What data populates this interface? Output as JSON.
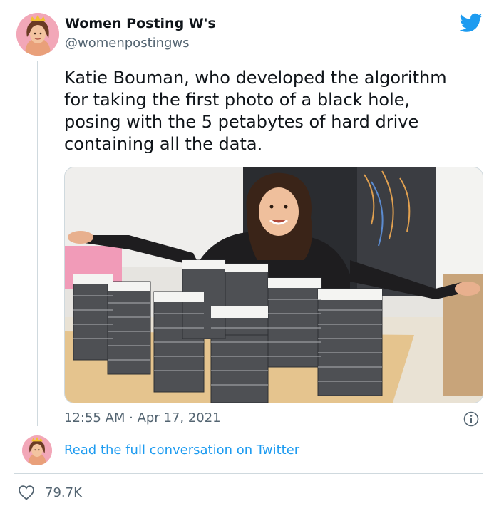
{
  "author": {
    "display_name": "Women Posting W's",
    "handle": "@womenpostingws"
  },
  "tweet": {
    "text": "Katie Bouman, who developed the algorithm\nfor taking the first photo of a black hole,\nposing with the 5 petabytes of hard drive\ncontaining all the data.",
    "timestamp": "12:55 AM · Apr 17, 2021",
    "likes": "79.7K"
  },
  "conversation_link": "Read the full conversation on Twitter",
  "icons": {
    "brand": "twitter-bird-icon",
    "info": "info-icon",
    "like": "heart-icon"
  },
  "colors": {
    "twitter_blue": "#1d9bf0",
    "secondary_text": "#536471",
    "border": "#cfd9de"
  }
}
